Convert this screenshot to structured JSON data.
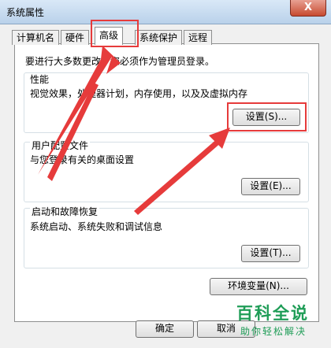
{
  "window": {
    "title": "系统属性",
    "close_label": "X"
  },
  "tabs": [
    {
      "label": "计算机名"
    },
    {
      "label": "硬件"
    },
    {
      "label": "高级"
    },
    {
      "label": "系统保护"
    },
    {
      "label": "远程"
    }
  ],
  "intro": "要进行大多数更改，您必须作为管理员登录。",
  "performance": {
    "title": "性能",
    "description": "视觉效果，处理器计划，内存使用，以及及虚拟内存",
    "button": "设置(S)..."
  },
  "profile": {
    "title": "用户配置文件",
    "description": "与您登录有关的桌面设置",
    "button": "设置(E)..."
  },
  "startup": {
    "title": "启动和故障恢复",
    "description": "系统启动、系统失败和调试信息",
    "button": "设置(T)..."
  },
  "env_button": "环境变量(N)...",
  "ok_button": "确定",
  "cancel_button": "取消",
  "watermark": {
    "title": "百科全说",
    "subtitle": "助你轻松解决"
  },
  "colors": {
    "annotation": "#e63b3b",
    "watermark": "#1f9d57"
  }
}
